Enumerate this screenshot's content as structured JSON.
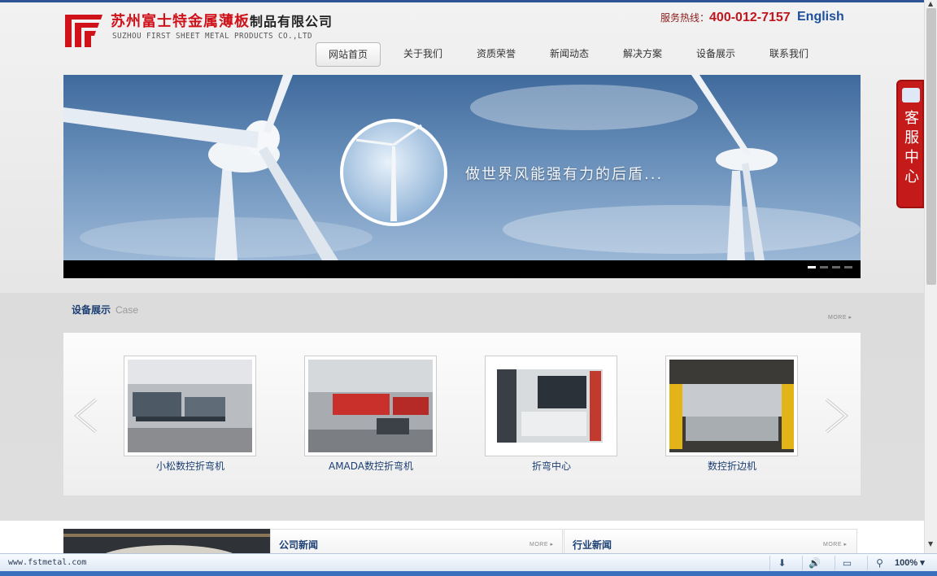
{
  "header": {
    "company_cn_red": "苏州富士特金属薄板",
    "company_cn_black": "制品有限公司",
    "company_en": "SUZHOU FIRST SHEET METAL PRODUCTS CO.,LTD",
    "hotline_label": "服务热线：",
    "hotline_number": "400-012-7157",
    "language_link": "English"
  },
  "nav": [
    {
      "label": "网站首页",
      "active": true
    },
    {
      "label": "关于我们"
    },
    {
      "label": "资质荣誉"
    },
    {
      "label": "新闻动态"
    },
    {
      "label": "解决方案"
    },
    {
      "label": "设备展示"
    },
    {
      "label": "联系我们"
    }
  ],
  "banner": {
    "slogan": "做世界风能强有力的后盾...",
    "slide_count": 4,
    "active_slide": 1
  },
  "equipment": {
    "title_cn": "设备展示",
    "title_en": "Case",
    "more": "MORE",
    "items": [
      {
        "caption": "小松数控折弯机"
      },
      {
        "caption": "AMADA数控折弯机"
      },
      {
        "caption": "折弯中心"
      },
      {
        "caption": "数控折边机"
      }
    ]
  },
  "news": {
    "company_title": "公司新闻",
    "industry_title": "行业新闻",
    "more": "MORE"
  },
  "service": {
    "label": "客服中心"
  },
  "statusbar": {
    "url": "www.fstmetal.com",
    "zoom": "100%"
  },
  "colors": {
    "brand_red": "#d0121b",
    "nav_blue": "#1b3f73",
    "link_blue": "#1d4f9c"
  }
}
